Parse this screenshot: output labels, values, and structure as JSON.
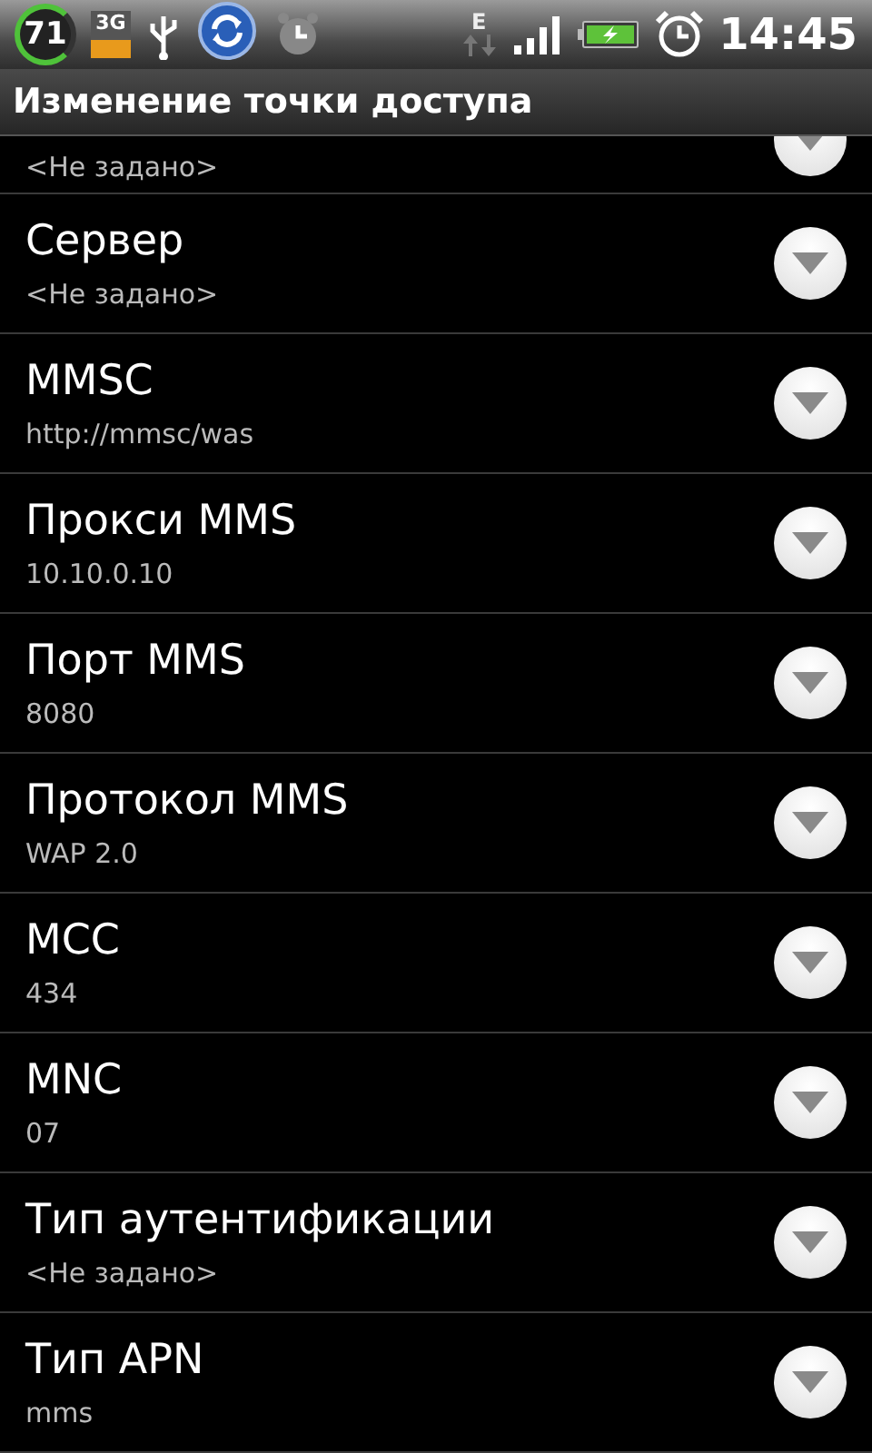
{
  "status_bar": {
    "battery_percent": "71",
    "network_badge": "3G",
    "data_type": "E",
    "time": "14:45"
  },
  "title": "Изменение точки доступа",
  "preferences": [
    {
      "summary": "<Не задано>"
    },
    {
      "title": "Сервер",
      "summary": "<Не задано>"
    },
    {
      "title": "MMSC",
      "summary": "http://mmsc/was"
    },
    {
      "title": "Прокси MMS",
      "summary": "10.10.0.10"
    },
    {
      "title": "Порт MMS",
      "summary": "8080"
    },
    {
      "title": "Протокол MMS",
      "summary": "WAP 2.0"
    },
    {
      "title": "MCC",
      "summary": "434"
    },
    {
      "title": "MNC",
      "summary": "07"
    },
    {
      "title": "Тип аутентификации",
      "summary": "<Не задано>"
    },
    {
      "title": "Тип APN",
      "summary": "mms"
    }
  ]
}
